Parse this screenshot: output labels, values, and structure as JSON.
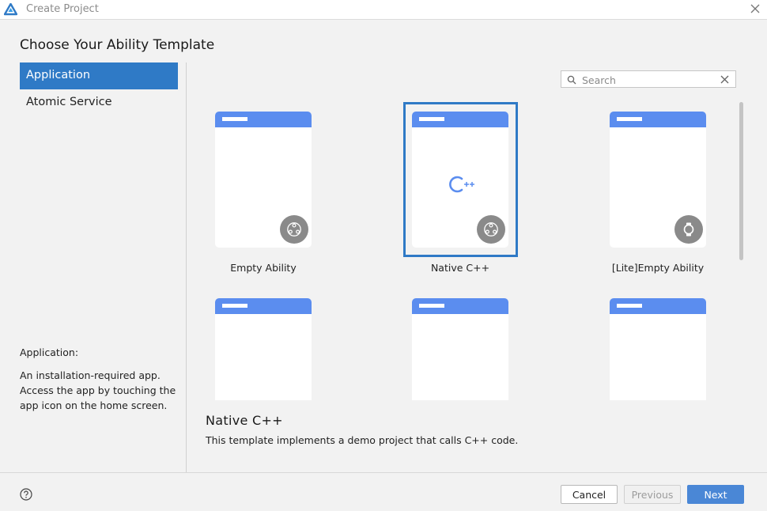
{
  "window": {
    "title": "Create Project",
    "logo_icon": "deveco-logo-icon",
    "close_icon": "close-icon"
  },
  "heading": "Choose Your Ability Template",
  "sidebar": {
    "items": [
      {
        "label": "Application",
        "active": true
      },
      {
        "label": "Atomic Service",
        "active": false
      }
    ],
    "description": {
      "title": "Application:",
      "body": "An installation-required app. Access the app by touching the app icon on the home screen."
    }
  },
  "search": {
    "placeholder": "Search",
    "value": ""
  },
  "templates": [
    {
      "label": "Empty Ability",
      "badge": "phone-ability-icon",
      "selected": false
    },
    {
      "label": "Native C++",
      "badge": "phone-ability-icon",
      "selected": true,
      "center_logo": "C++"
    },
    {
      "label": "[Lite]Empty Ability",
      "badge": "watch-icon",
      "selected": false
    },
    {
      "label": "",
      "selected": false
    },
    {
      "label": "",
      "selected": false
    },
    {
      "label": "",
      "selected": false
    }
  ],
  "detail": {
    "title": "Native C++",
    "description": "This template implements a demo project that calls C++ code."
  },
  "footer": {
    "cancel_label": "Cancel",
    "previous_label": "Previous",
    "next_label": "Next",
    "previous_enabled": false
  },
  "colors": {
    "accent": "#2f7ac6",
    "card_header": "#5b8def",
    "next_button": "#4a87d6",
    "badge": "#8a8a8a"
  }
}
